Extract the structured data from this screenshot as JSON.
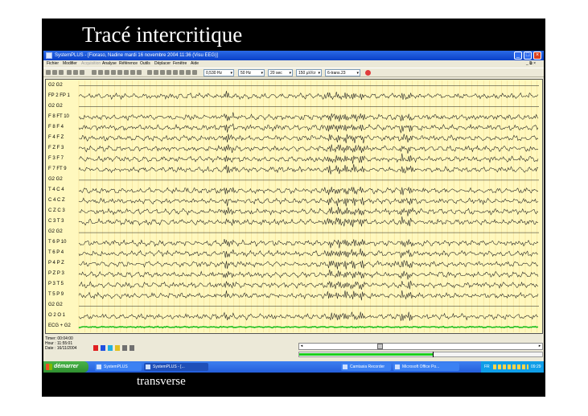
{
  "slide": {
    "title": "Tracé intercritique",
    "caption": "transverse",
    "background": "#000000",
    "text_color": "#ffffff"
  },
  "window": {
    "title": "SystemPLUS - [Fioraso, Nadine mardi 16 novembre 2004 11:36 (Visu EEG)]",
    "app_icon": "systemplus-app-icon",
    "controls": [
      "minimize-icon",
      "maximize-icon",
      "close-icon"
    ]
  },
  "menubar": {
    "items": [
      {
        "label": "Fichier",
        "enabled": true
      },
      {
        "label": "Modifier",
        "enabled": true
      },
      {
        "label": "Acquisition",
        "enabled": false
      },
      {
        "label": "Analyse",
        "enabled": true
      },
      {
        "label": "Référence",
        "enabled": true
      },
      {
        "label": "Outils",
        "enabled": true
      },
      {
        "label": "Déplacer",
        "enabled": true
      },
      {
        "label": "Fenêtre",
        "enabled": true
      },
      {
        "label": "Aide",
        "enabled": true
      }
    ]
  },
  "toolbar": {
    "combos": [
      {
        "name": "filter-combo",
        "value": "0,530 Hz"
      },
      {
        "name": "lowpass-combo",
        "value": "50 Hz"
      },
      {
        "name": "timebase-combo",
        "value": "20 sec"
      },
      {
        "name": "gain-combo",
        "value": "150 µV/cr"
      },
      {
        "name": "montage-combo",
        "value": "6-trans.23"
      }
    ]
  },
  "eeg": {
    "background": "#fff8be",
    "trace_color": "#1a1a1a",
    "ecg_color": "#20c020",
    "channels": [
      "G2 G2",
      "FP 2 FP 1",
      "G2 G2",
      "F 8 FT 10",
      "F 8 F 4",
      "F 4 F Z",
      "F Z F 3",
      "F 3 F 7",
      "F 7 FT 9",
      "G2 G2",
      "T 4 C 4",
      "C 4 C Z",
      "C Z C 3",
      "C 3 T 3",
      "G2 G2",
      "T 6 P 10",
      "T 6 P 4",
      "P 4 P Z",
      "P Z P 3",
      "P 3 T 5",
      "T 5 P 9",
      "G2 G2",
      "O 2 O 1",
      "ECG + G2"
    ],
    "flat_channels": [
      "G2 G2"
    ],
    "ecg_channel": "ECG + G2"
  },
  "status": {
    "timer": "Timer: 00:04:00",
    "hour": "Hour : 11:55:01",
    "date": "Date : 16/11/2004",
    "flags": [
      {
        "icon": "red-flag-icon",
        "color": "#e02020"
      },
      {
        "icon": "blue-flag-icon",
        "color": "#2050e0"
      },
      {
        "icon": "cyan-flag-icon",
        "color": "#20b0e0"
      },
      {
        "icon": "yellow-flag-icon",
        "color": "#e0c020"
      },
      {
        "icon": "marker-icon",
        "color": "#707070"
      },
      {
        "icon": "hand-icon",
        "color": "#707070"
      }
    ]
  },
  "navigation": {
    "slider_fraction": 0.32,
    "progress_fraction": 0.55
  },
  "taskbar": {
    "start_label": "démarrer",
    "tasks": [
      {
        "label": "SystemPLUS",
        "active": false
      },
      {
        "label": "SystemPLUS - [...",
        "active": true
      },
      {
        "label": "Camtasia Recorder",
        "active": false
      },
      {
        "label": "Microsoft Office Po...",
        "active": false
      }
    ],
    "tray_lang": "FR",
    "clock": "09:29"
  }
}
